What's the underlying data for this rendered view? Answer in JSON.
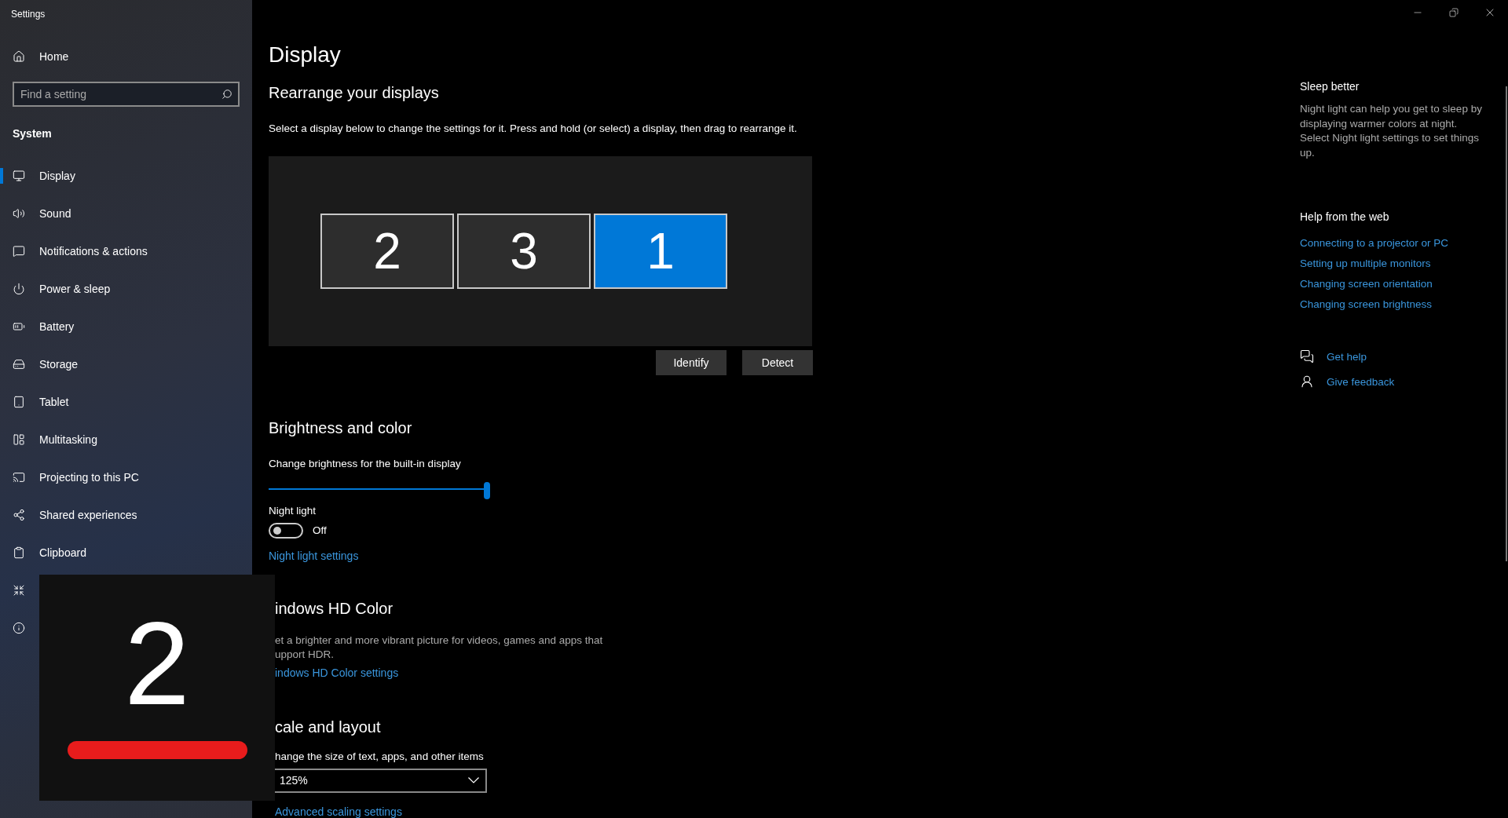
{
  "window": {
    "title": "Settings"
  },
  "sidebar": {
    "home": "Home",
    "search": {
      "placeholder": "Find a setting"
    },
    "section": "System",
    "items": [
      {
        "label": "Display",
        "selected": true
      },
      {
        "label": "Sound",
        "selected": false
      },
      {
        "label": "Notifications & actions",
        "selected": false
      },
      {
        "label": "Power & sleep",
        "selected": false
      },
      {
        "label": "Battery",
        "selected": false
      },
      {
        "label": "Storage",
        "selected": false
      },
      {
        "label": "Tablet",
        "selected": false
      },
      {
        "label": "Multitasking",
        "selected": false
      },
      {
        "label": "Projecting to this PC",
        "selected": false
      },
      {
        "label": "Shared experiences",
        "selected": false
      },
      {
        "label": "Clipboard",
        "selected": false
      },
      {
        "selected": false
      },
      {
        "selected": false
      }
    ]
  },
  "main": {
    "title": "Display",
    "rearrange": {
      "heading": "Rearrange your displays",
      "description": "Select a display below to change the settings for it. Press and hold (or select) a display, then drag to rearrange it.",
      "monitors": [
        {
          "label": "2",
          "selected": false
        },
        {
          "label": "3",
          "selected": false
        },
        {
          "label": "1",
          "selected": true
        }
      ],
      "buttons": [
        "Identify",
        "Detect"
      ]
    },
    "brightness": {
      "heading": "Brightness and color",
      "slider_label": "Change brightness for the built-in display",
      "level": 1,
      "night_light": {
        "label": "Night light",
        "on": false,
        "state_text": "Off"
      },
      "link": "Night light settings"
    },
    "hd_color": {
      "heading": "indows HD Color",
      "description": [
        "et a brighter and more vibrant picture for videos, games and apps that",
        "upport HDR."
      ],
      "link": "indows HD Color settings"
    },
    "scale": {
      "heading": "cale and layout",
      "label": "hange the size of text, apps, and other items",
      "dropdown": "125%",
      "link": "Advanced scaling settings"
    }
  },
  "side_panel": {
    "sleep": {
      "heading": "Sleep better",
      "text": "Night light can help you get to sleep by displaying warmer colors at night. Select Night light settings to set things up."
    },
    "web": {
      "heading": "Help from the web",
      "links": [
        "Connecting to a projector or PC",
        "Setting up multiple monitors",
        "Changing screen orientation",
        "Changing screen brightness"
      ]
    },
    "actions": [
      "Get help",
      "Give feedback"
    ]
  },
  "identify_overlay": {
    "number": "2"
  }
}
